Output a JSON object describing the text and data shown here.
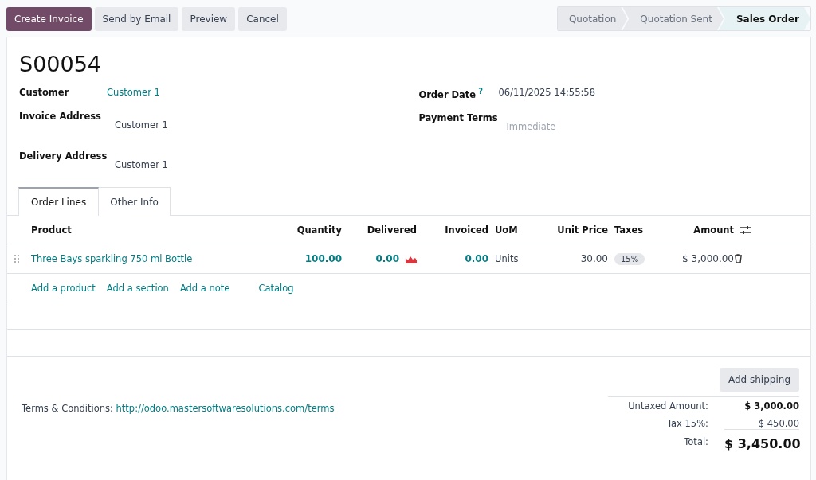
{
  "actions": [
    {
      "label": "Create Invoice",
      "primary": true
    },
    {
      "label": "Send by Email",
      "primary": false
    },
    {
      "label": "Preview",
      "primary": false
    },
    {
      "label": "Cancel",
      "primary": false
    }
  ],
  "stages": [
    {
      "label": "Quotation",
      "selected": false
    },
    {
      "label": "Quotation Sent",
      "selected": false
    },
    {
      "label": "Sales Order",
      "selected": true
    }
  ],
  "title": "S00054",
  "left_fields": [
    {
      "label": "Customer",
      "value": "Customer 1",
      "kind": "link"
    },
    {
      "label": "Invoice Address",
      "value": "Customer 1",
      "kind": "text"
    },
    {
      "label": "Delivery Address",
      "value": "Customer 1",
      "kind": "text"
    }
  ],
  "right_fields": [
    {
      "label": "Order Date",
      "help": "?",
      "value": "06/11/2025 14:55:58",
      "kind": "text"
    },
    {
      "label": "Payment Terms",
      "value": "Immediate",
      "kind": "muted"
    }
  ],
  "tabs": [
    {
      "label": "Order Lines",
      "selected": true
    },
    {
      "label": "Other Info",
      "selected": false
    }
  ],
  "columns": [
    "Product",
    "Quantity",
    "Delivered",
    "Invoiced",
    "UoM",
    "Unit Price",
    "Taxes",
    "Amount"
  ],
  "rows": [
    {
      "product": "Three Bays sparkling 750 ml Bottle",
      "quantity": "100.00",
      "delivered": "0.00",
      "invoiced": "0.00",
      "uom": "Units",
      "unit_price": "30.00",
      "taxes": "15%",
      "amount": "$ 3,000.00"
    }
  ],
  "add_links": [
    "Add a product",
    "Add a section",
    "Add a note",
    "Catalog"
  ],
  "add_shipping": "Add shipping",
  "terms": {
    "label": "Terms & Conditions:",
    "link": "http://odoo.mastersoftwaresolutions.com/terms"
  },
  "totals": [
    {
      "label": "Untaxed Amount:",
      "value": "$ 3,000.00",
      "kind": "bold"
    },
    {
      "label": "Tax 15%:",
      "value": "$ 450.00",
      "kind": "plain"
    },
    {
      "label": "Total:",
      "value": "$ 3,450.00",
      "kind": "grand"
    }
  ]
}
